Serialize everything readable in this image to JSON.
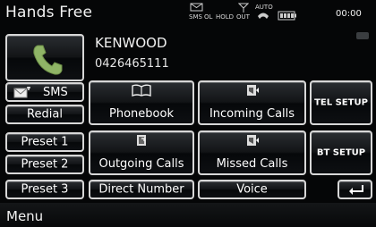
{
  "header": {
    "title": "Hands Free",
    "status_sms": "SMS",
    "status_ol": "OL",
    "status_hold": "HOLD",
    "status_out": "OUT",
    "status_auto": "AUTO",
    "time": "00:00"
  },
  "contact": {
    "name": "KENWOOD",
    "number": "0426465111"
  },
  "buttons": {
    "sms": "SMS",
    "redial": "Redial",
    "preset1": "Preset 1",
    "preset2": "Preset 2",
    "preset3": "Preset 3",
    "phonebook": "Phonebook",
    "incoming_calls": "Incoming Calls",
    "outgoing_calls": "Outgoing Calls",
    "missed_calls": "Missed Calls",
    "direct_number": "Direct Number",
    "voice": "Voice",
    "tel_setup": "TEL SETUP",
    "bt_setup": "BT SETUP"
  },
  "footer": {
    "menu": "Menu"
  },
  "icons": {
    "phone": "handset-icon",
    "sms": "envelope-icon",
    "phonebook": "book-icon",
    "incoming": "incoming-call-icon",
    "outgoing": "outgoing-call-icon",
    "missed": "missed-call-icon",
    "back": "return-arrow-icon"
  },
  "colors": {
    "background": "#050607",
    "button_border": "#d7d7d7",
    "text": "#ffffff",
    "phone_icon": "#7fa75a"
  }
}
